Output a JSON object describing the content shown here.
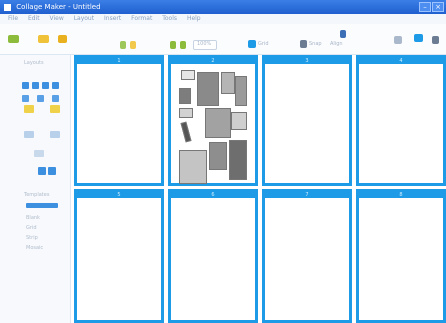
{
  "window": {
    "title": "Collage Maker - Untitled"
  },
  "menu": {
    "items": [
      "File",
      "Edit",
      "View",
      "Layout",
      "Insert",
      "Format",
      "Tools",
      "Help"
    ]
  },
  "toolbar": {
    "open": "Open",
    "save": "Save",
    "print": "Print",
    "zoom": "100%",
    "grid": "Grid",
    "snap": "Snap",
    "align": "Align",
    "colors": {
      "open": "#8dbb3c",
      "save": "#f0c23a",
      "print": "#e9b11f",
      "accent": "#1e9be6"
    }
  },
  "sidebar": {
    "section_title": "Layouts",
    "templates_title": "Templates",
    "items": [
      "Blank",
      "Grid",
      "Strip",
      "Mosaic"
    ]
  },
  "pages": [
    {
      "number": "1",
      "caption": ""
    },
    {
      "number": "2",
      "caption": ""
    },
    {
      "number": "3",
      "caption": ""
    },
    {
      "number": "4",
      "caption": ""
    },
    {
      "number": "5",
      "caption": ""
    },
    {
      "number": "6",
      "caption": ""
    },
    {
      "number": "7",
      "caption": ""
    },
    {
      "number": "8",
      "caption": ""
    }
  ]
}
